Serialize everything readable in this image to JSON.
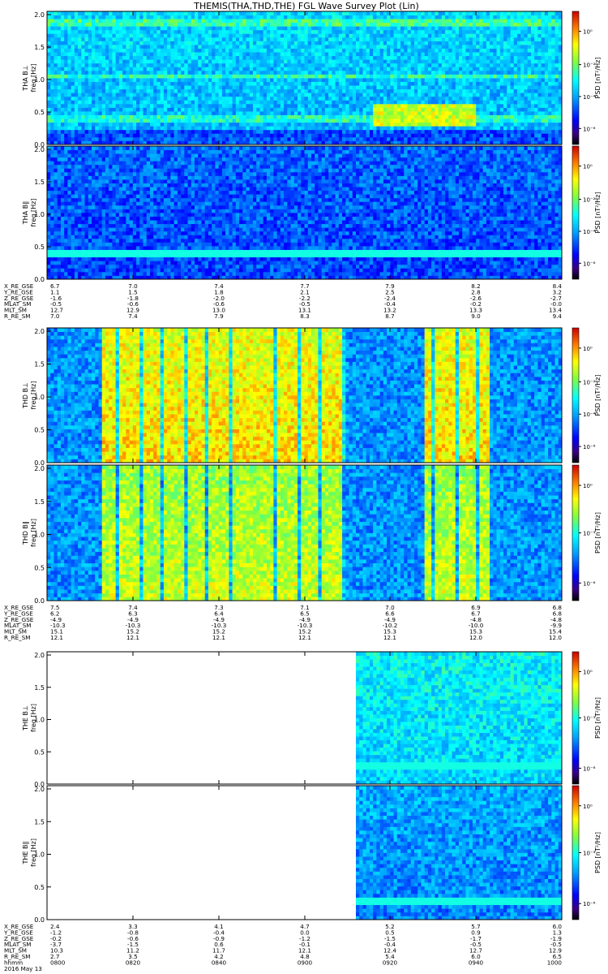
{
  "title": "THEMIS(THA,THD,THE) FGL Wave Survey Plot (Lin)",
  "chart_data": {
    "type": "heatmap",
    "x_label": "hhmm",
    "date": "2016 May 13",
    "x_time_ticks": [
      "0800",
      "0820",
      "0840",
      "0900",
      "0920",
      "0940",
      "1000"
    ],
    "y_label": "freq [Hz]",
    "y_ticks": [
      "0.0",
      "0.5",
      "1.0",
      "1.5",
      "2.0"
    ],
    "ylim": [
      0,
      2.0
    ],
    "colorbar_label": "PSD [nT²/Hz]",
    "colorbar_ticks_a": [
      "10⁰",
      "10⁻²",
      "10⁻⁴",
      "10⁻⁶"
    ],
    "colorbar_ticks_b": [
      "10⁰",
      "10⁻³",
      "10⁻⁶"
    ],
    "colorbar_ticks_c": [
      "10⁰",
      "10⁻³",
      "10⁻⁶"
    ],
    "probes": [
      {
        "id": "THA",
        "panels": [
          {
            "label": "THA B⊥",
            "cbar": "a"
          },
          {
            "label": "THA B∥",
            "cbar": "a"
          }
        ],
        "ephemeris_labels": [
          "X_RE_GSE",
          "Y_RE_GSE",
          "Z_RE_GSE",
          "MLAT_SM",
          "MLT_SM",
          "R_RE_SM"
        ],
        "ephemeris": [
          [
            "6.7",
            "7.0",
            "7.4",
            "7.7",
            "7.9",
            "8.2",
            "8.4"
          ],
          [
            "1.1",
            "1.5",
            "1.8",
            "2.1",
            "2.5",
            "2.8",
            "3.2"
          ],
          [
            "-1.6",
            "-1.8",
            "-2.0",
            "-2.2",
            "-2.4",
            "-2.6",
            "-2.7"
          ],
          [
            "-0.5",
            "-0.6",
            "-0.6",
            "-0.5",
            "-0.4",
            "-0.2",
            "-0.0"
          ],
          [
            "12.7",
            "12.9",
            "13.0",
            "13.1",
            "13.2",
            "13.3",
            "13.4"
          ],
          [
            "7.0",
            "7.4",
            "7.9",
            "8.3",
            "8.7",
            "9.0",
            "9.4"
          ]
        ]
      },
      {
        "id": "THD",
        "panels": [
          {
            "label": "THD B⊥",
            "cbar": "a"
          },
          {
            "label": "THD B∥",
            "cbar": "b"
          }
        ],
        "ephemeris_labels": [
          "X_RE_GSE",
          "Y_RE_GSE",
          "Z_RE_GSE",
          "MLAT_SM",
          "MLT_SM",
          "R_RE_SM"
        ],
        "ephemeris": [
          [
            "7.5",
            "7.4",
            "7.3",
            "7.1",
            "7.0",
            "6.9",
            "6.8"
          ],
          [
            "6.2",
            "6.3",
            "6.4",
            "6.5",
            "6.6",
            "6.7",
            "6.8"
          ],
          [
            "-4.9",
            "-4.9",
            "-4.9",
            "-4.9",
            "-4.9",
            "-4.8",
            "-4.8"
          ],
          [
            "-10.3",
            "-10.3",
            "-10.3",
            "-10.3",
            "-10.2",
            "-10.0",
            "-9.9"
          ],
          [
            "15.1",
            "15.2",
            "15.2",
            "15.2",
            "15.3",
            "15.3",
            "15.4"
          ],
          [
            "12.1",
            "12.1",
            "12.1",
            "12.1",
            "12.1",
            "12.0",
            "12.0"
          ]
        ]
      },
      {
        "id": "THE",
        "panels": [
          {
            "label": "THE B⊥",
            "cbar": "c"
          },
          {
            "label": "THE B∥",
            "cbar": "c"
          }
        ],
        "ephemeris_labels": [
          "X_RE_GSE",
          "Y_RE_GSE",
          "Z_RE_GSE",
          "MLAT_SM",
          "MLT_SM",
          "R_RE_SM",
          "hhmm"
        ],
        "ephemeris": [
          [
            "2.4",
            "3.3",
            "4.1",
            "4.7",
            "5.2",
            "5.7",
            "6.0"
          ],
          [
            "-1.2",
            "-0.8",
            "-0.4",
            "0.0",
            "0.5",
            "0.9",
            "1.3"
          ],
          [
            "-0.2",
            "-0.6",
            "-0.9",
            "-1.2",
            "-1.5",
            "-1.7",
            "-1.9"
          ],
          [
            "-3.7",
            "-1.5",
            "0.6",
            "-0.1",
            "-0.4",
            "-0.5",
            "-0.5"
          ],
          [
            "10.3",
            "11.2",
            "11.7",
            "12.1",
            "12.4",
            "12.7",
            "12.9"
          ],
          [
            "2.7",
            "3.5",
            "4.2",
            "4.8",
            "5.4",
            "6.0",
            "6.5"
          ]
        ]
      }
    ]
  }
}
